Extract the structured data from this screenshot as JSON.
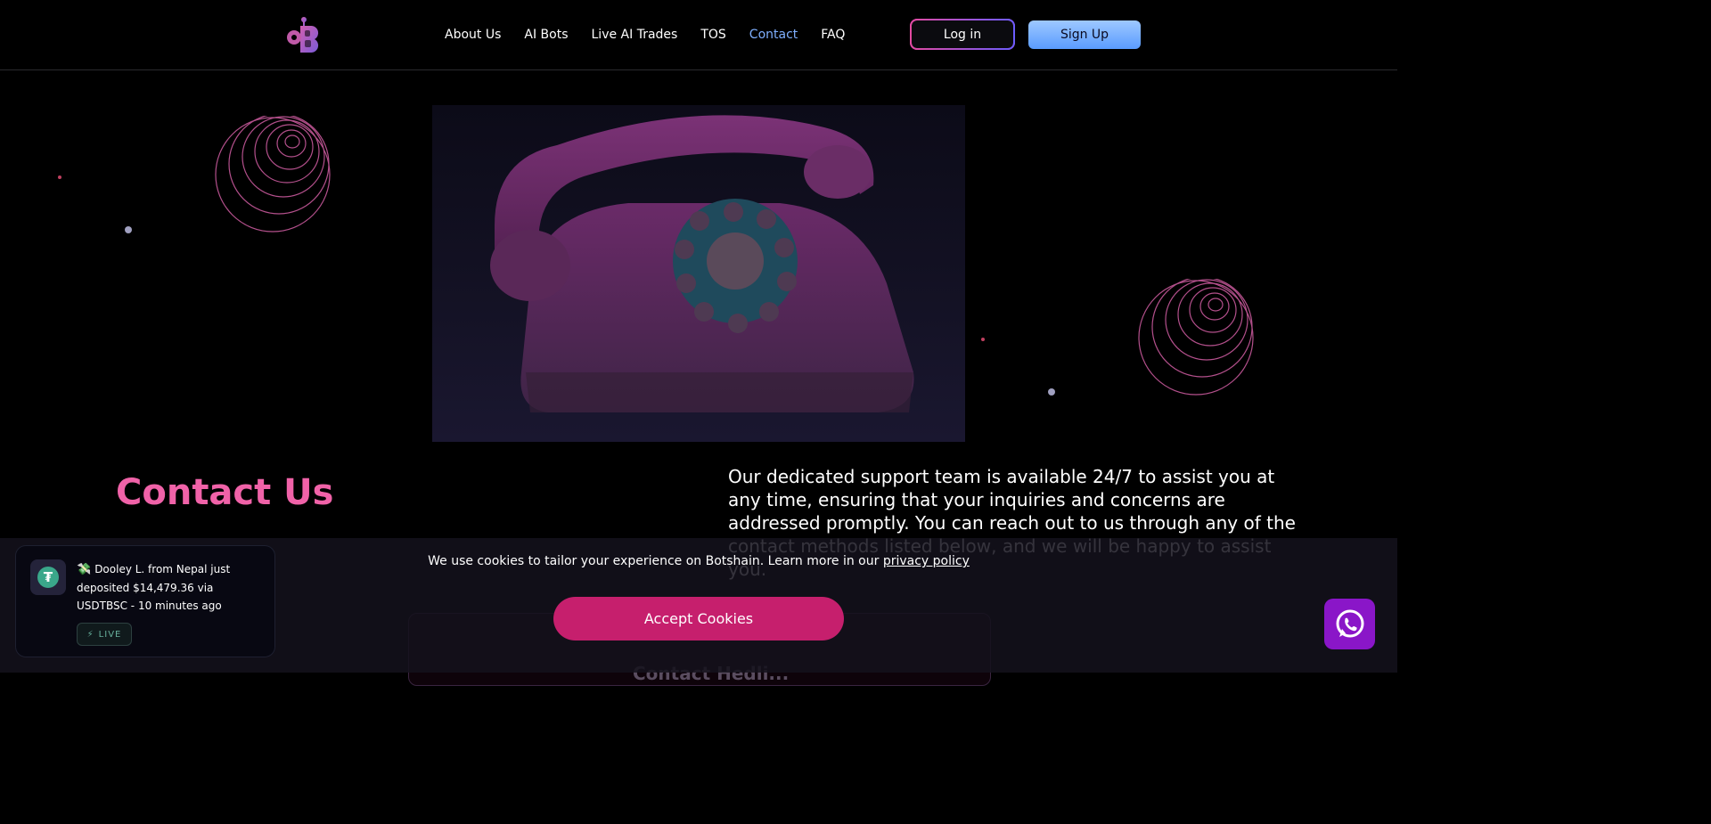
{
  "nav": {
    "items": [
      {
        "label": "About Us",
        "active": false
      },
      {
        "label": "AI Bots",
        "active": false
      },
      {
        "label": "Live AI Trades",
        "active": false
      },
      {
        "label": "TOS",
        "active": false
      },
      {
        "label": "Contact",
        "active": true
      },
      {
        "label": "FAQ",
        "active": false
      }
    ],
    "login_label": "Log in",
    "signup_label": "Sign Up"
  },
  "hero": {
    "title": "Contact Us",
    "description": "Our dedicated support team is available 24/7 to assist you at any time, ensuring that your inquiries and concerns are addressed promptly. You can reach out to us through any of the contact methods listed below, and we will be happy to assist you."
  },
  "form": {
    "heading_partial": "Contact Hedli..."
  },
  "cookie": {
    "text": "We use cookies to tailor your experience on Botshain. Learn more in our ",
    "link_label": "privacy policy",
    "accept_label": "Accept Cookies"
  },
  "toast": {
    "message": "Dooley L. from Nepal just deposited $14,479.36 via USDTBSC - 10 minutes ago",
    "badge": "LIVE"
  },
  "colors": {
    "accent_pink": "#f062a8",
    "active_nav": "#7fb0ff",
    "accept_button": "#c61f6d",
    "whatsapp_bg": "#8a16c8"
  },
  "icons": {
    "logo": "botshain-logo",
    "toast": "tether-icon",
    "chat": "whatsapp-icon"
  }
}
